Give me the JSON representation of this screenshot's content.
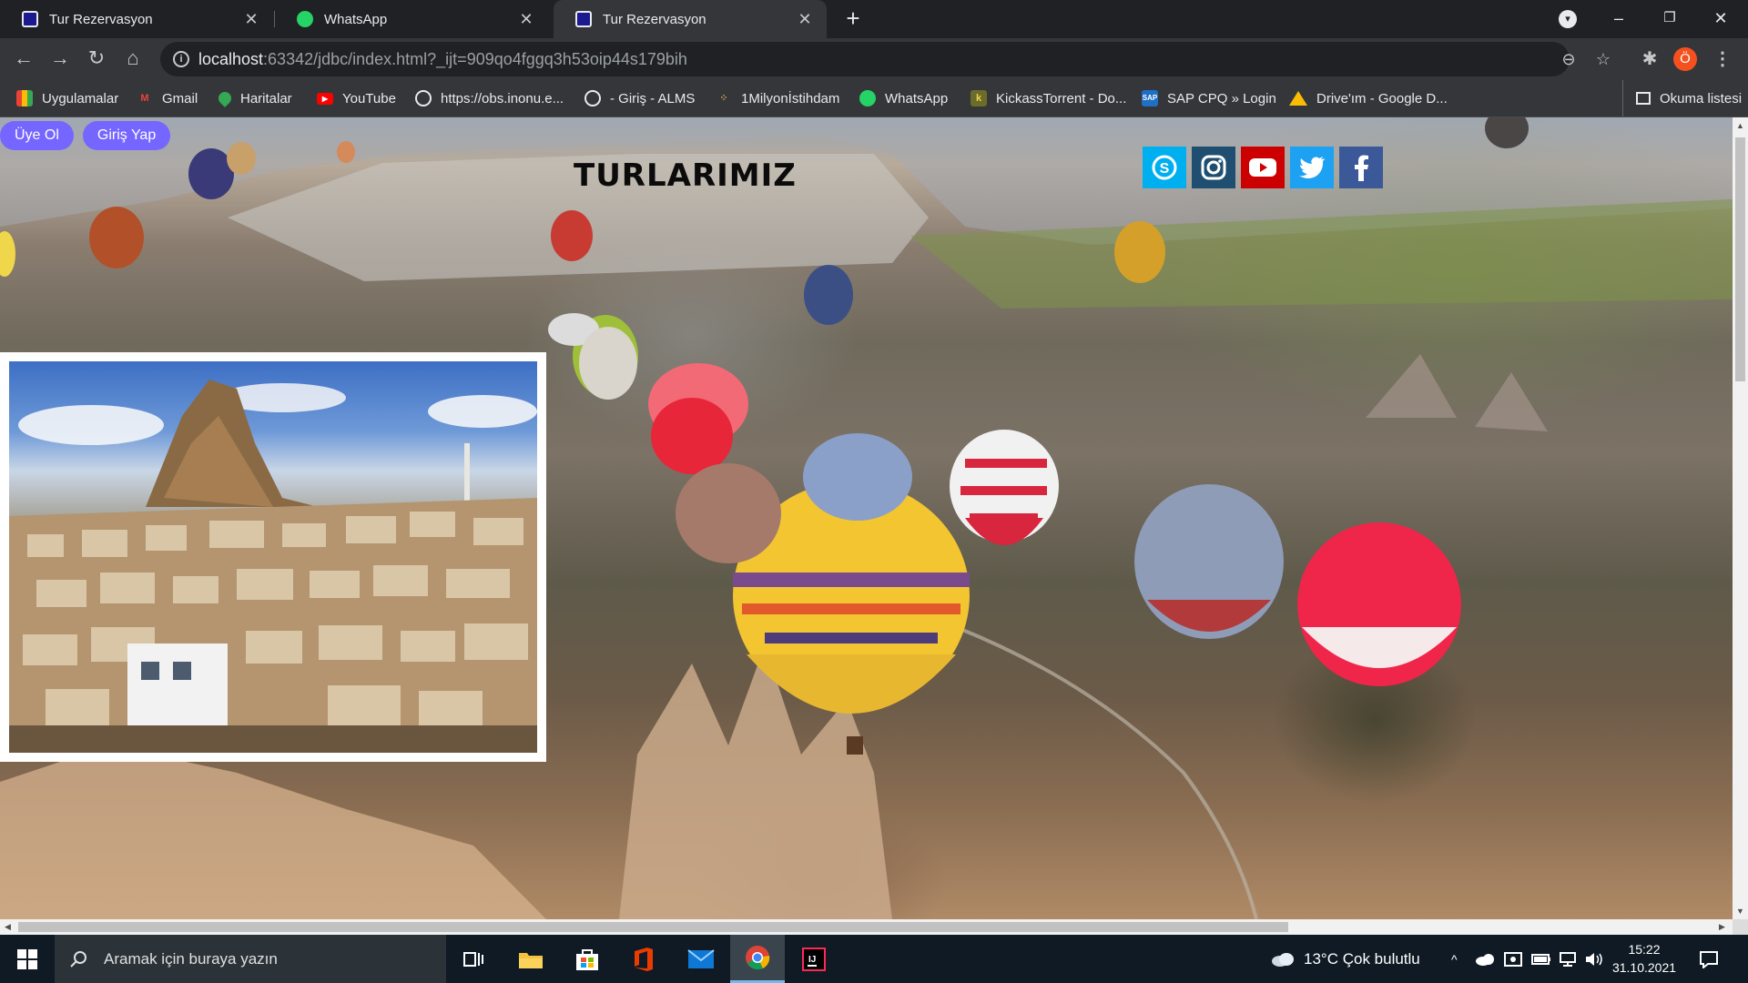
{
  "browser": {
    "tabs": [
      {
        "title": "Tur Rezervasyon",
        "active": false
      },
      {
        "title": "WhatsApp",
        "active": false
      },
      {
        "title": "Tur Rezervasyon",
        "active": true
      }
    ],
    "new_tab_symbol": "+",
    "window_controls": {
      "minimize": "–",
      "maximize": "❐",
      "close": "✕"
    },
    "address": {
      "host": "localhost",
      "rest": ":63342/jdbc/index.html?_ijt=909qo4fggq3h53oip44s179bih"
    },
    "profile_initial": "Ö",
    "bookmarks": [
      {
        "label": "Uygulamalar",
        "icon": "apps-grid-icon"
      },
      {
        "label": "Gmail",
        "icon": "gmail-icon"
      },
      {
        "label": "Haritalar",
        "icon": "maps-icon"
      },
      {
        "label": "YouTube",
        "icon": "youtube-icon"
      },
      {
        "label": "https://obs.inonu.e...",
        "icon": "globe-icon"
      },
      {
        "label": "- Giriş - ALMS",
        "icon": "globe-icon"
      },
      {
        "label": "1Milyonİstihdam",
        "icon": "star-dots-icon"
      },
      {
        "label": "WhatsApp",
        "icon": "whatsapp-icon"
      },
      {
        "label": "KickassTorrent - Do...",
        "icon": "kickass-icon"
      },
      {
        "label": "SAP CPQ » Login",
        "icon": "sap-icon"
      },
      {
        "label": "Drive'ım - Google D...",
        "icon": "drive-icon"
      }
    ],
    "reading_list": "Okuma listesi"
  },
  "page": {
    "buttons": {
      "signup": "Üye Ol",
      "login": "Giriş Yap"
    },
    "title": "TURLARIMIZ",
    "social": [
      "skype-icon",
      "instagram-icon",
      "youtube-icon",
      "twitter-icon",
      "facebook-icon"
    ],
    "colors": {
      "pill": "#7466ff",
      "skype": "#00aff0",
      "instagram": "#1f4e70",
      "youtube": "#cc0000",
      "twitter": "#1da1f2",
      "facebook": "#3b5998"
    }
  },
  "taskbar": {
    "search_placeholder": "Aramak için buraya yazın",
    "weather": "13°C  Çok bulutlu",
    "time": "15:22",
    "date": "31.10.2021"
  }
}
